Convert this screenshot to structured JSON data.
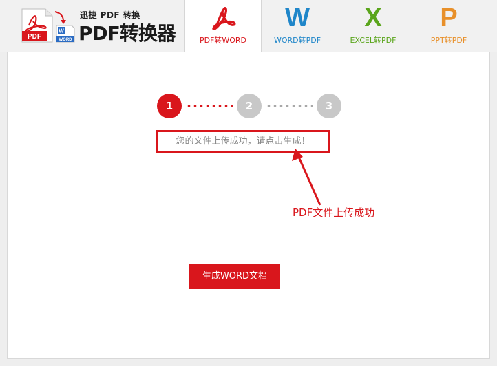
{
  "colors": {
    "accent_red": "#d9161c",
    "word_blue": "#1f86c9",
    "excel_green": "#5aa51b",
    "ppt_orange": "#e8902a",
    "step_inactive": "#c8c8c8"
  },
  "header": {
    "logo_top_text": "迅捷 PDF 转换",
    "logo_main_text": "PDF转换器",
    "logo_pdf_badge": "PDF",
    "logo_word_badge": "WORD",
    "tabs": [
      {
        "label": "PDF转WORD",
        "icon": "pdf-acrobat-icon",
        "active": true
      },
      {
        "label": "WORD转PDF",
        "letter": "W",
        "icon": "word-icon",
        "active": false
      },
      {
        "label": "EXCEL转PDF",
        "letter": "X",
        "icon": "excel-icon",
        "active": false
      },
      {
        "label": "PPT转PDF",
        "letter": "P",
        "icon": "ppt-icon",
        "active": false
      }
    ]
  },
  "steps": {
    "current": 1,
    "items": [
      "1",
      "2",
      "3"
    ]
  },
  "status_message": "您的文件上传成功，请点击生成！",
  "annotation": "PDF文件上传成功",
  "generate_button": "生成WORD文档"
}
